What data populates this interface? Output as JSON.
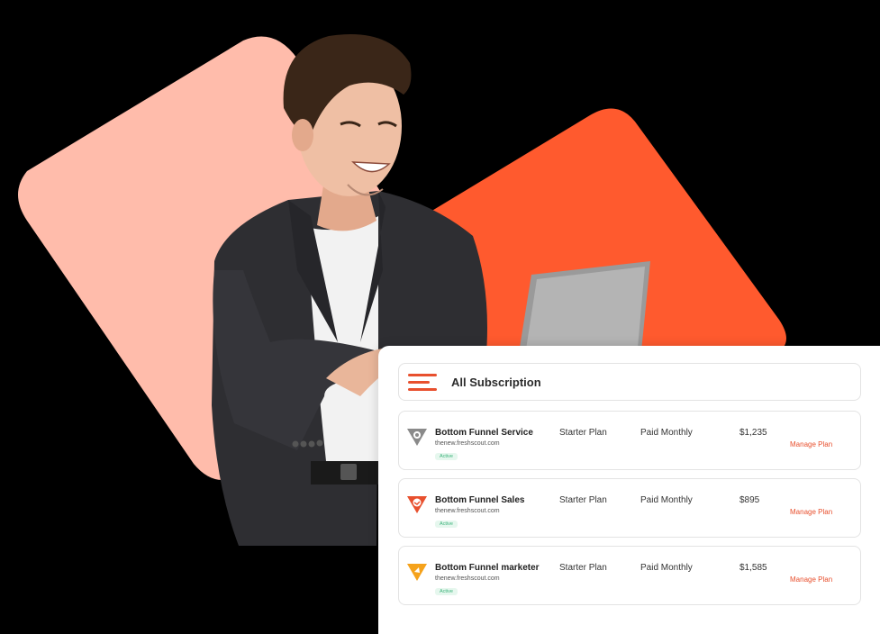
{
  "colors": {
    "accent": "#e8502e",
    "peach": "#ffbcab",
    "orange": "#ff5a2e",
    "active_badge_text": "#3bb37a",
    "active_badge_bg": "#e6f7ee"
  },
  "header": {
    "menu_icon": "menu-lines-icon",
    "title": "All Subscription"
  },
  "subscriptions": [
    {
      "name": "Bottom Funnel Service",
      "url": "thenew.freshscout.com",
      "status": "Active",
      "plan": "Starter Plan",
      "billing": "Paid Monthly",
      "price": "$1,235",
      "action": "Manage Plan",
      "logo_icon": "gear-funnel-icon",
      "logo_color": "#8a8a8a"
    },
    {
      "name": "Bottom Funnel Sales",
      "url": "thenew.freshscout.com",
      "status": "Active",
      "plan": "Starter Plan",
      "billing": "Paid Monthly",
      "price": "$895",
      "action": "Manage Plan",
      "logo_icon": "handshake-funnel-icon",
      "logo_color": "#e8502e"
    },
    {
      "name": "Bottom Funnel marketer",
      "url": "thenew.freshscout.com",
      "status": "Active",
      "plan": "Starter Plan",
      "billing": "Paid Monthly",
      "price": "$1,585",
      "action": "Manage Plan",
      "logo_icon": "megaphone-funnel-icon",
      "logo_color": "#f5a21b"
    }
  ]
}
